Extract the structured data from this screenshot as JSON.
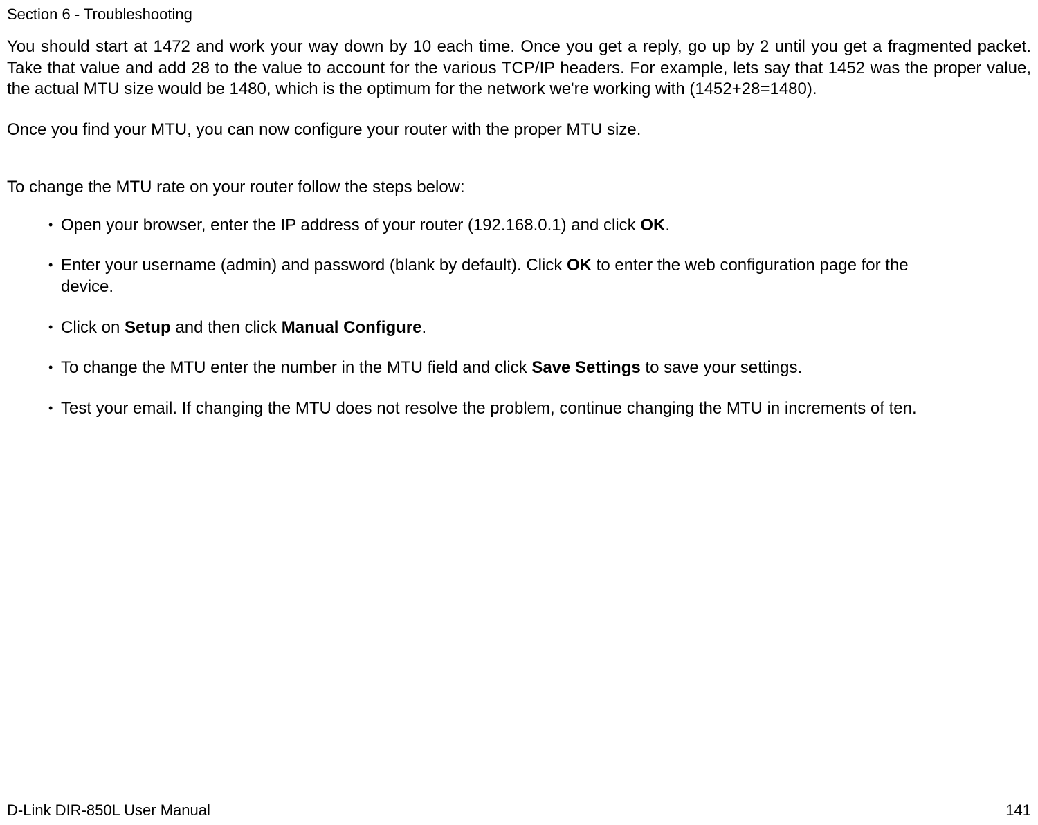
{
  "header": {
    "section": "Section 6 - Troubleshooting"
  },
  "body": {
    "para1": "You should start at 1472 and work your way down by 10 each time. Once you get a reply, go up by 2 until you get a fragmented packet. Take that value and add 28 to the value to account for the various TCP/IP headers. For example, lets say that 1452 was the proper value, the actual MTU size would be 1480, which is the optimum for the network we're working with (1452+28=1480).",
    "para2": "Once you find your MTU, you can now configure your router with the proper MTU size.",
    "para3": "To change the MTU rate on your router follow the steps below:",
    "bullets": [
      {
        "pre": "Open your browser, enter the IP address of your router (192.168.0.1) and click ",
        "b1": "OK",
        "post": "."
      },
      {
        "pre": "Enter your username (admin) and password (blank by default). Click ",
        "b1": "OK",
        "post": " to enter the web configuration page for the device."
      },
      {
        "pre": "Click on ",
        "b1": "Setup",
        "mid": " and then click ",
        "b2": "Manual Configure",
        "post": "."
      },
      {
        "pre": "To change the MTU enter the number in the MTU field and click ",
        "b1": "Save Settings",
        "post": " to save your settings."
      },
      {
        "pre": "Test your email. If changing the MTU does not resolve the problem, continue changing the MTU in increments of ten.",
        "b1": "",
        "post": ""
      }
    ]
  },
  "footer": {
    "manual": "D-Link DIR-850L User Manual",
    "page": "141"
  }
}
